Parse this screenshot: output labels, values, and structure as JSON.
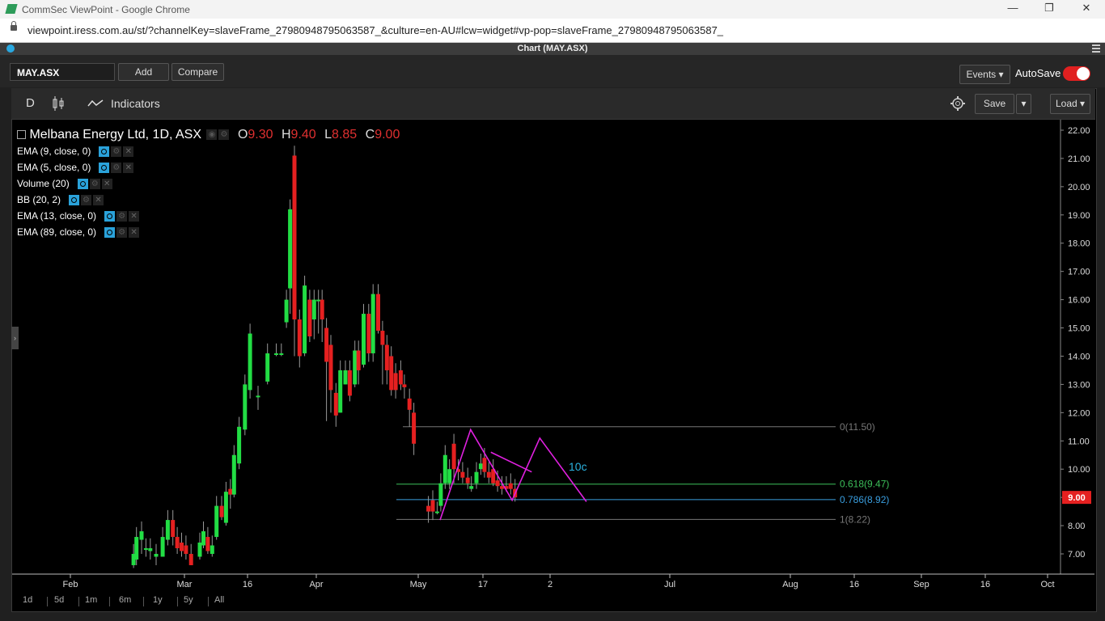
{
  "os": {
    "window_title": "CommSec ViewPoint - Google Chrome",
    "minimize": "—",
    "restore": "❐",
    "close": "✕"
  },
  "browser": {
    "url": "viewpoint.iress.com.au/st/?channelKey=slaveFrame_27980948795063587_&culture=en-AU#lcw=widget#vp-pop=slaveFrame_27980948795063587_"
  },
  "app": {
    "window_title": "Chart (MAY.ASX)",
    "symbol": "MAY.ASX",
    "add_label": "Add",
    "compare_label": "Compare",
    "events_label": "Events ▾",
    "autosave_label": "AutoSave",
    "autosave_on": true
  },
  "toolbar": {
    "interval": "D",
    "indicators_label": "Indicators",
    "save_label": "Save",
    "save_dropdown": "▾",
    "load_label": "Load ▾"
  },
  "legend": {
    "title": "Melbana Energy Ltd, 1D, ASX",
    "o_label": "O",
    "o_value": "9.30",
    "h_label": "H",
    "h_value": "9.40",
    "l_label": "L",
    "l_value": "8.85",
    "c_label": "C",
    "c_value": "9.00",
    "indicators": [
      "EMA (9, close, 0)",
      "EMA (5, close, 0)",
      "Volume (20)",
      "BB (20, 2)",
      "EMA (13, close, 0)",
      "EMA (89, close, 0)"
    ]
  },
  "chart_data": {
    "type": "candlestick",
    "ylim": [
      6.6,
      22.3
    ],
    "y_ticks": [
      "22.00",
      "21.00",
      "20.00",
      "19.00",
      "18.00",
      "17.00",
      "16.00",
      "15.00",
      "14.00",
      "13.00",
      "12.00",
      "11.00",
      "10.00",
      "9.00",
      "8.00",
      "7.00"
    ],
    "x_ticks": [
      "Feb",
      "Mar",
      "16",
      "Apr",
      "May",
      "17",
      "2",
      "Jul",
      "Aug",
      "16",
      "Sep",
      "16",
      "Oct"
    ],
    "last_price": "9.00",
    "annotation": "10c",
    "fib_levels": [
      {
        "label": "0(11.50)",
        "value": 11.5,
        "color": "#777777"
      },
      {
        "label": "0.618(9.47)",
        "value": 9.47,
        "color": "#3cbf5a"
      },
      {
        "label": "0.786(8.92)",
        "value": 8.92,
        "color": "#3a9fe0"
      },
      {
        "label": "1(8.22)",
        "value": 8.22,
        "color": "#777777"
      }
    ],
    "candles": [
      [
        9.9,
        6.6,
        7.0,
        6.5
      ],
      [
        10.3,
        6.8,
        7.6,
        6.6
      ],
      [
        11.0,
        7.5,
        7.8,
        7.0
      ],
      [
        11.6,
        7.2,
        7.2,
        6.9
      ],
      [
        12.2,
        7.1,
        7.2,
        6.8
      ],
      [
        13.0,
        6.9,
        7.0,
        6.6
      ],
      [
        13.9,
        6.9,
        7.6,
        6.9
      ],
      [
        14.6,
        7.5,
        8.2,
        7.3
      ],
      [
        15.3,
        8.2,
        7.6,
        7.3
      ],
      [
        15.9,
        7.6,
        7.2,
        7.0
      ],
      [
        16.5,
        7.4,
        7.1,
        6.9
      ],
      [
        17.1,
        7.3,
        7.0,
        6.8
      ],
      [
        17.8,
        7.0,
        6.6,
        6.6
      ],
      [
        19.0,
        6.9,
        7.4,
        6.8
      ],
      [
        19.5,
        7.3,
        7.8,
        7.2
      ],
      [
        20.1,
        7.6,
        7.1,
        7.0
      ],
      [
        20.7,
        7.0,
        7.3,
        6.9
      ],
      [
        21.3,
        7.6,
        8.7,
        7.5
      ],
      [
        22.0,
        8.7,
        8.3,
        8.2
      ],
      [
        22.6,
        8.1,
        9.2,
        8.0
      ],
      [
        23.2,
        9.3,
        9.1,
        8.6
      ],
      [
        23.7,
        9.1,
        10.5,
        9.0
      ],
      [
        24.4,
        10.2,
        11.5,
        10.0
      ],
      [
        25.2,
        11.4,
        13.0,
        11.2
      ],
      [
        25.9,
        12.8,
        14.8,
        12.5
      ],
      [
        27.0,
        12.6,
        12.6,
        12.1
      ],
      [
        28.3,
        13.1,
        14.1,
        13.0
      ],
      [
        29.5,
        14.1,
        14.1,
        14.0
      ],
      [
        30.2,
        14.1,
        14.1,
        14.0
      ],
      [
        30.9,
        15.2,
        16.0,
        15.0
      ],
      [
        31.4,
        16.4,
        19.2,
        15.5
      ],
      [
        32.0,
        21.1,
        15.3,
        14.0
      ],
      [
        32.7,
        15.3,
        14.0,
        13.6
      ],
      [
        33.4,
        14.1,
        16.5,
        14.0
      ],
      [
        34.1,
        16.0,
        14.7,
        14.5
      ],
      [
        34.7,
        15.3,
        16.0,
        14.6
      ],
      [
        35.3,
        16.0,
        16.0,
        14.8
      ],
      [
        35.8,
        16.0,
        15.3,
        14.5
      ],
      [
        36.4,
        15.0,
        13.8,
        11.7
      ],
      [
        37.0,
        14.4,
        12.8,
        12.0
      ],
      [
        37.7,
        12.7,
        11.9,
        11.5
      ],
      [
        38.3,
        12.0,
        13.5,
        12.0
      ],
      [
        39.0,
        13.0,
        13.5,
        13.0
      ],
      [
        39.6,
        13.5,
        12.6,
        12.4
      ],
      [
        40.3,
        13.0,
        14.2,
        12.9
      ],
      [
        40.8,
        14.2,
        13.5,
        13.0
      ],
      [
        41.5,
        13.7,
        15.5,
        13.6
      ],
      [
        42.2,
        15.5,
        14.1,
        13.8
      ],
      [
        42.8,
        14.1,
        16.2,
        13.8
      ],
      [
        43.5,
        16.2,
        14.9,
        14.8
      ],
      [
        44.1,
        14.9,
        14.4,
        13.0
      ],
      [
        44.7,
        14.4,
        13.5,
        13.0
      ],
      [
        45.3,
        14.0,
        12.8,
        12.6
      ],
      [
        45.9,
        13.4,
        12.8,
        12.5
      ],
      [
        46.6,
        13.5,
        13.0,
        12.8
      ],
      [
        47.1,
        13.0,
        12.9,
        12.5
      ],
      [
        47.8,
        12.5,
        12.1,
        11.5
      ],
      [
        48.4,
        12.0,
        10.9,
        10.5
      ],
      [
        50.4,
        8.7,
        8.5,
        8.1
      ],
      [
        51.0,
        8.9,
        8.5,
        8.2
      ],
      [
        51.6,
        8.5,
        8.5,
        8.4
      ],
      [
        52.1,
        8.7,
        9.5,
        8.5
      ],
      [
        52.7,
        9.5,
        10.5,
        9.3
      ],
      [
        53.3,
        9.5,
        10.0,
        9.3
      ],
      [
        53.9,
        10.9,
        10.0,
        9.5
      ],
      [
        54.5,
        10.0,
        9.9,
        9.6
      ],
      [
        55.1,
        9.9,
        9.7,
        9.5
      ],
      [
        55.8,
        9.7,
        9.5,
        9.3
      ],
      [
        56.3,
        9.3,
        9.4,
        9.2
      ],
      [
        57.0,
        9.5,
        9.9,
        9.3
      ],
      [
        57.6,
        10.0,
        10.2,
        9.8
      ],
      [
        58.1,
        10.4,
        9.9,
        9.7
      ],
      [
        58.7,
        9.9,
        9.7,
        9.5
      ],
      [
        59.3,
        10.0,
        9.5,
        9.4
      ],
      [
        59.9,
        9.6,
        9.4,
        9.2
      ],
      [
        60.5,
        9.4,
        9.3,
        9.1
      ],
      [
        61.1,
        9.4,
        9.3,
        9.2
      ],
      [
        61.7,
        9.5,
        9.3,
        9.1
      ],
      [
        62.3,
        9.3,
        9.0,
        8.85
      ]
    ]
  },
  "range_buttons": [
    "1d",
    "5d",
    "1m",
    "6m",
    "1y",
    "5y",
    "All"
  ],
  "colors": {
    "up": "#22dd44",
    "down": "#e52020",
    "pattern": "#e020e0",
    "annotation": "#2bb3e0",
    "price_tag": "#e52020"
  }
}
